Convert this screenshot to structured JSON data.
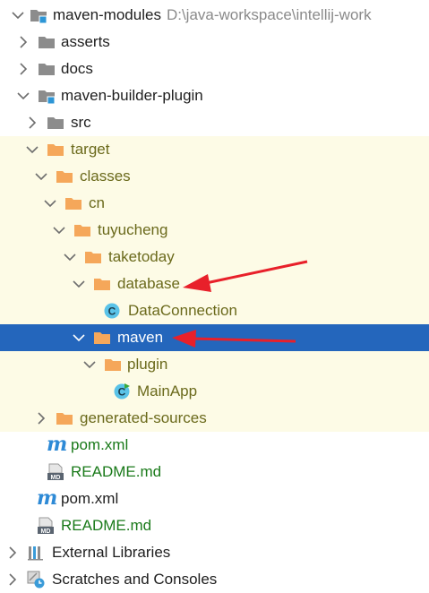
{
  "colors": {
    "folder_gray": "#8c8c8c",
    "folder_orange": "#f5a75a",
    "module_badge": "#2d96d6",
    "class_circle": "#5ac3e8",
    "selection": "#2466bc",
    "excluded_bg": "#fdfbe6",
    "annotation_arrow": "#e8202a"
  },
  "tree": {
    "root": {
      "label": "maven-modules",
      "path": "D:\\java-workspace\\intellij-work",
      "icon": "module-folder-icon"
    },
    "asserts": {
      "label": "asserts",
      "icon": "folder-icon"
    },
    "docs": {
      "label": "docs",
      "icon": "folder-icon"
    },
    "plugin_module": {
      "label": "maven-builder-plugin",
      "icon": "module-folder-icon"
    },
    "src": {
      "label": "src",
      "icon": "folder-icon"
    },
    "target": {
      "label": "target",
      "icon": "excluded-folder-icon"
    },
    "classes": {
      "label": "classes",
      "icon": "excluded-folder-icon"
    },
    "cn": {
      "label": "cn",
      "icon": "excluded-folder-icon"
    },
    "tuyucheng": {
      "label": "tuyucheng",
      "icon": "excluded-folder-icon"
    },
    "taketoday": {
      "label": "taketoday",
      "icon": "excluded-folder-icon"
    },
    "database": {
      "label": "database",
      "icon": "excluded-folder-icon"
    },
    "dataconnection": {
      "label": "DataConnection",
      "icon": "class-icon"
    },
    "maven": {
      "label": "maven",
      "icon": "excluded-folder-icon",
      "selected": true
    },
    "plugin": {
      "label": "plugin",
      "icon": "excluded-folder-icon"
    },
    "mainapp": {
      "label": "MainApp",
      "icon": "runnable-class-icon"
    },
    "generated": {
      "label": "generated-sources",
      "icon": "excluded-folder-icon"
    },
    "pom_inner": {
      "label": "pom.xml",
      "icon": "maven-icon"
    },
    "readme_inner": {
      "label": "README.md",
      "icon": "markdown-icon"
    },
    "pom_root": {
      "label": "pom.xml",
      "icon": "maven-icon"
    },
    "readme_root": {
      "label": "README.md",
      "icon": "markdown-icon"
    },
    "external": {
      "label": "External Libraries",
      "icon": "library-icon"
    },
    "scratches": {
      "label": "Scratches and Consoles",
      "icon": "scratches-icon"
    }
  },
  "icon_text": {
    "markdown_badge": "MD",
    "class_letter": "C",
    "maven_letter": "m"
  }
}
